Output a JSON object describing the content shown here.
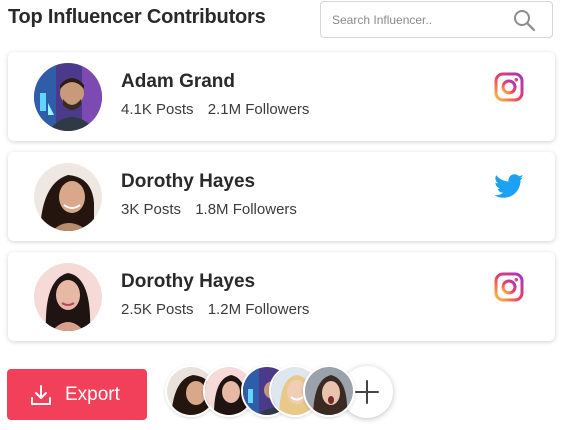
{
  "header": {
    "title": "Top Influencer Contributors"
  },
  "search": {
    "placeholder": "Search Influencer..",
    "icon": "search-icon"
  },
  "influencers": [
    {
      "name": "Adam Grand",
      "posts": "4.1K Posts",
      "followers": "2.1M Followers",
      "platform": "instagram"
    },
    {
      "name": "Dorothy Hayes",
      "posts": "3K Posts",
      "followers": "1.8M Followers",
      "platform": "twitter"
    },
    {
      "name": "Dorothy Hayes",
      "posts": "2.5K Posts",
      "followers": "1.2M Followers",
      "platform": "instagram"
    }
  ],
  "footer": {
    "export_label": "Export",
    "export_icon": "download-icon",
    "add_icon": "plus-icon"
  },
  "colors": {
    "accent": "#f2405a",
    "twitter": "#1da1f2",
    "instagram_start": "#f9c243",
    "instagram_end": "#a233c9"
  }
}
